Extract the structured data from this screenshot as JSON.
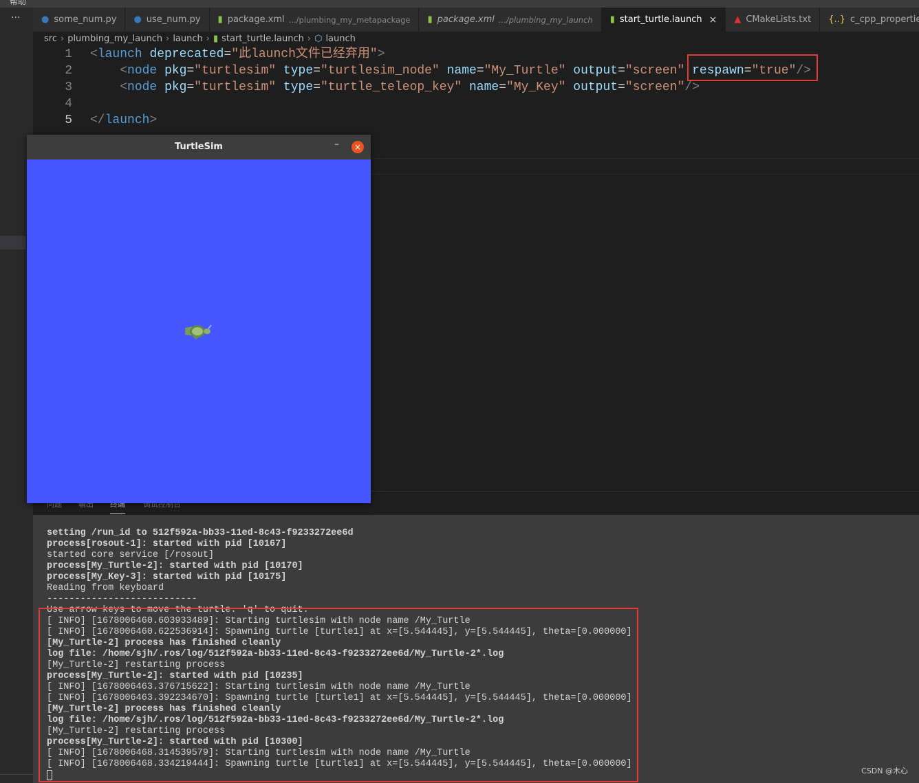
{
  "menubar": {
    "item": "帮助"
  },
  "activity": {
    "more": "···"
  },
  "tabs": [
    {
      "label": "some_num.py",
      "icon": "python-icon",
      "color": "#3b78b7"
    },
    {
      "label": "use_num.py",
      "icon": "python-icon",
      "color": "#3b78b7"
    },
    {
      "label": "package.xml",
      "desc": ".../plumbing_my_metapackage",
      "icon": "xml-file-icon"
    },
    {
      "label": "package.xml",
      "desc": ".../plumbing_my_launch",
      "icon": "xml-file-icon",
      "italic": true
    },
    {
      "label": "start_turtle.launch",
      "icon": "xml-file-icon",
      "active": true,
      "close": "×"
    },
    {
      "label": "CMakeLists.txt",
      "icon": "cmake-icon"
    },
    {
      "label": "c_cpp_properties",
      "icon": "json-icon",
      "glyph": "{..}"
    }
  ],
  "breadcrumb": [
    "src",
    "plumbing_my_launch",
    "launch",
    "start_turtle.launch",
    "launch"
  ],
  "editor": {
    "line_numbers": [
      "1",
      "2",
      "3",
      "4",
      "5"
    ],
    "line1": {
      "open": "<",
      "tag": "launch",
      "attr": "deprecated",
      "eq": "=",
      "val": "\"此launch文件已经弃用\"",
      "close": ">"
    },
    "line2": {
      "open": "<",
      "tag": "node",
      "a1": "pkg",
      "v1": "\"turtlesim\"",
      "a2": "type",
      "v2": "\"turtlesim_node\"",
      "a3": "name",
      "v3": "\"My_Turtle\"",
      "a4": "output",
      "v4": "\"screen\"",
      "a5": "respawn",
      "v5": "\"true\"",
      "close": "/>"
    },
    "line3": {
      "open": "<",
      "tag": "node",
      "a1": "pkg",
      "v1": "\"turtlesim\"",
      "a2": "type",
      "v2": "\"turtle_teleop_key\"",
      "a3": "name",
      "v3": "\"My_Key\"",
      "a4": "output",
      "v4": "\"screen\"",
      "close": "/>"
    },
    "line5": {
      "open": "</",
      "tag": "launch",
      "close": ">"
    }
  },
  "turtlesim": {
    "title": "TurtleSim",
    "minimize": "–",
    "close": "×",
    "bg": "#4556ff"
  },
  "panel": {
    "tabs": [
      "问题",
      "输出",
      "终端",
      "调试控制台"
    ]
  },
  "terminal": {
    "lines": [
      {
        "text": "setting /run_id to 512f592a-bb33-11ed-8c43-f9233272ee6d",
        "bold": true
      },
      {
        "text": "process[rosout-1]: started with pid [10167]",
        "bold": true
      },
      {
        "text": "started core service [/rosout]",
        "bold": false
      },
      {
        "text": "process[My_Turtle-2]: started with pid [10170]",
        "bold": true
      },
      {
        "text": "process[My_Key-3]: started with pid [10175]",
        "bold": true
      },
      {
        "text": "Reading from keyboard",
        "bold": false
      },
      {
        "text": "---------------------------",
        "bold": false
      },
      {
        "text": "Use arrow keys to move the turtle. 'q' to quit.",
        "bold": false
      },
      {
        "text": "[ INFO] [1678006460.603933489]: Starting turtlesim with node name /My_Turtle",
        "bold": false
      },
      {
        "text": "[ INFO] [1678006460.622536914]: Spawning turtle [turtle1] at x=[5.544445], y=[5.544445], theta=[0.000000]",
        "bold": false
      },
      {
        "text": "[My_Turtle-2] process has finished cleanly",
        "bold": true
      },
      {
        "text": "log file: /home/sjh/.ros/log/512f592a-bb33-11ed-8c43-f9233272ee6d/My_Turtle-2*.log",
        "bold": true
      },
      {
        "text": "[My_Turtle-2] restarting process",
        "bold": false
      },
      {
        "text": "process[My_Turtle-2]: started with pid [10235]",
        "bold": true
      },
      {
        "text": "[ INFO] [1678006463.376715622]: Starting turtlesim with node name /My_Turtle",
        "bold": false
      },
      {
        "text": "[ INFO] [1678006463.392234670]: Spawning turtle [turtle1] at x=[5.544445], y=[5.544445], theta=[0.000000]",
        "bold": false
      },
      {
        "text": "[My_Turtle-2] process has finished cleanly",
        "bold": true
      },
      {
        "text": "log file: /home/sjh/.ros/log/512f592a-bb33-11ed-8c43-f9233272ee6d/My_Turtle-2*.log",
        "bold": true
      },
      {
        "text": "[My_Turtle-2] restarting process",
        "bold": false
      },
      {
        "text": "process[My_Turtle-2]: started with pid [10300]",
        "bold": true
      },
      {
        "text": "[ INFO] [1678006468.314539579]: Starting turtlesim with node name /My_Turtle",
        "bold": false
      },
      {
        "text": "[ INFO] [1678006468.334219444]: Spawning turtle [turtle1] at x=[5.544445], y=[5.544445], theta=[0.000000]",
        "bold": false
      }
    ]
  },
  "watermark": "CSDN @木心",
  "colors": {
    "highlight": "#e53935",
    "tag": "#569cd6",
    "attr": "#9cdcfe",
    "string": "#ce9178"
  }
}
